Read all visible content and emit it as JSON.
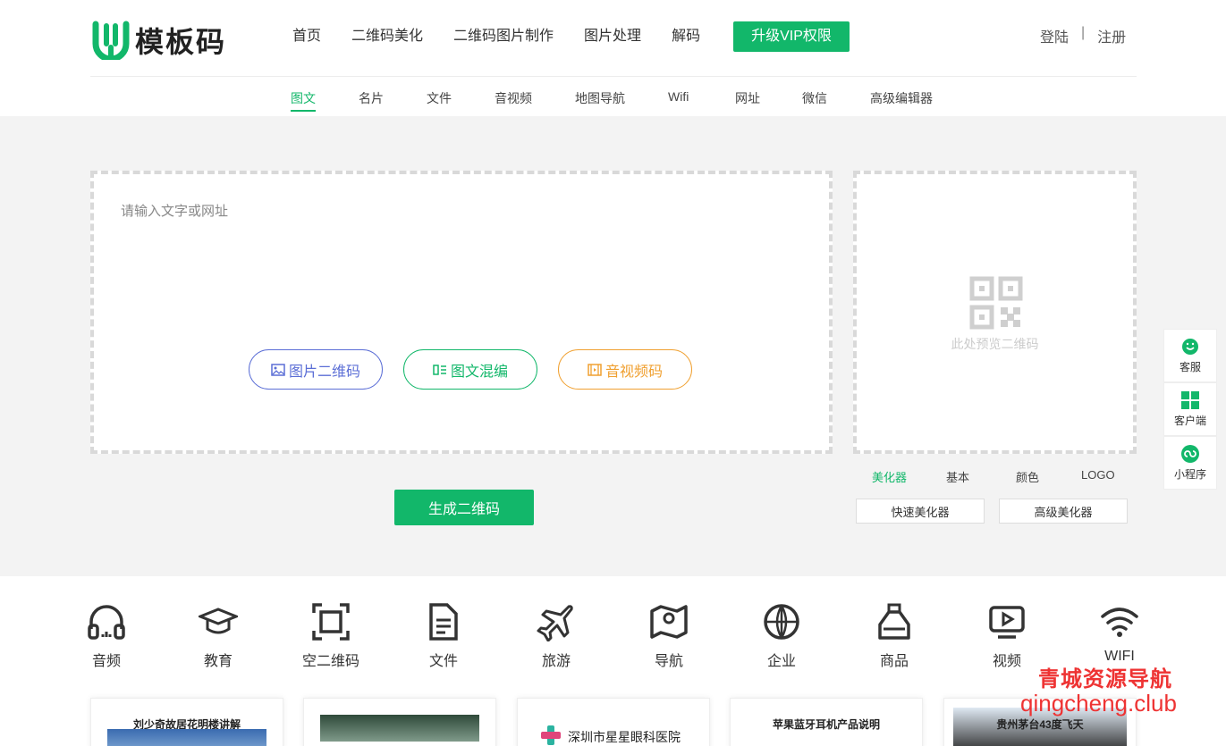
{
  "brand": {
    "name": "模板码",
    "color": "#12b76a"
  },
  "nav": {
    "items": [
      "首页",
      "二维码美化",
      "二维码图片制作",
      "图片处理",
      "解码"
    ],
    "vip": "升级VIP权限"
  },
  "auth": {
    "login": "登陆",
    "separator": "|",
    "register": "注册"
  },
  "subtabs": [
    "图文",
    "名片",
    "文件",
    "音视频",
    "地图导航",
    "Wifi",
    "网址",
    "微信",
    "高级编辑器"
  ],
  "editor": {
    "placeholder": "请输入文字或网址",
    "modes": {
      "image": "图片二维码",
      "mixed": "图文混编",
      "av": "音视频码"
    }
  },
  "generate_label": "生成二维码",
  "preview": {
    "text": "此处预览二维码"
  },
  "beautify": {
    "tabs": [
      "美化器",
      "基本",
      "颜色",
      "LOGO"
    ],
    "quick": "快速美化器",
    "advanced": "高级美化器"
  },
  "side": {
    "service": "客服",
    "client": "客户端",
    "miniapp": "小程序"
  },
  "categories": [
    {
      "label": "音频",
      "icon": "headphones-icon"
    },
    {
      "label": "教育",
      "icon": "graduation-cap-icon"
    },
    {
      "label": "空二维码",
      "icon": "scan-frame-icon"
    },
    {
      "label": "文件",
      "icon": "document-icon"
    },
    {
      "label": "旅游",
      "icon": "airplane-icon"
    },
    {
      "label": "导航",
      "icon": "map-pin-icon"
    },
    {
      "label": "企业",
      "icon": "globe-icon"
    },
    {
      "label": "商品",
      "icon": "bottle-icon"
    },
    {
      "label": "视频",
      "icon": "video-play-icon"
    },
    {
      "label": "WIFI",
      "icon": "wifi-icon"
    }
  ],
  "cards": [
    {
      "title": "刘少奇故居花明楼讲解"
    },
    {
      "title": ""
    },
    {
      "title": "深圳市星星眼科医院"
    },
    {
      "title": "苹果蓝牙耳机产品说明"
    },
    {
      "title": "贵州茅台43度飞天"
    }
  ],
  "watermark": {
    "line1": "青城资源导航",
    "line2": "qingcheng.club"
  }
}
